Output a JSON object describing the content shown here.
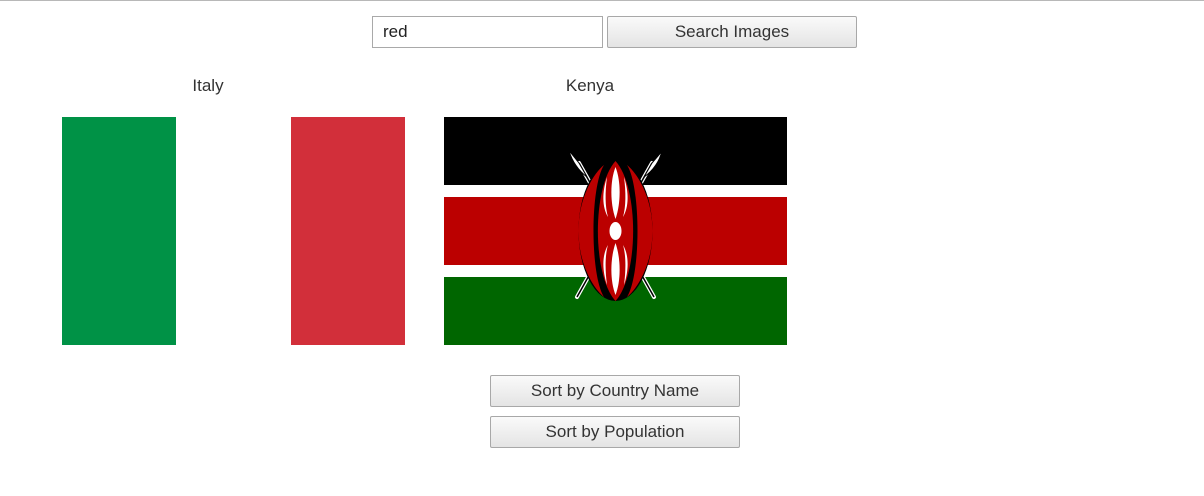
{
  "search": {
    "value": "red",
    "button_label": "Search Images"
  },
  "results": [
    {
      "country": "Italy",
      "flag": "italy-flag",
      "colors": [
        "#009246",
        "#ffffff",
        "#d22f3a"
      ]
    },
    {
      "country": "Kenya",
      "flag": "kenya-flag",
      "colors": [
        "#000000",
        "#ffffff",
        "#bb0000",
        "#006600"
      ]
    }
  ],
  "sort": {
    "by_name_label": "Sort by Country Name",
    "by_population_label": "Sort by Population"
  }
}
